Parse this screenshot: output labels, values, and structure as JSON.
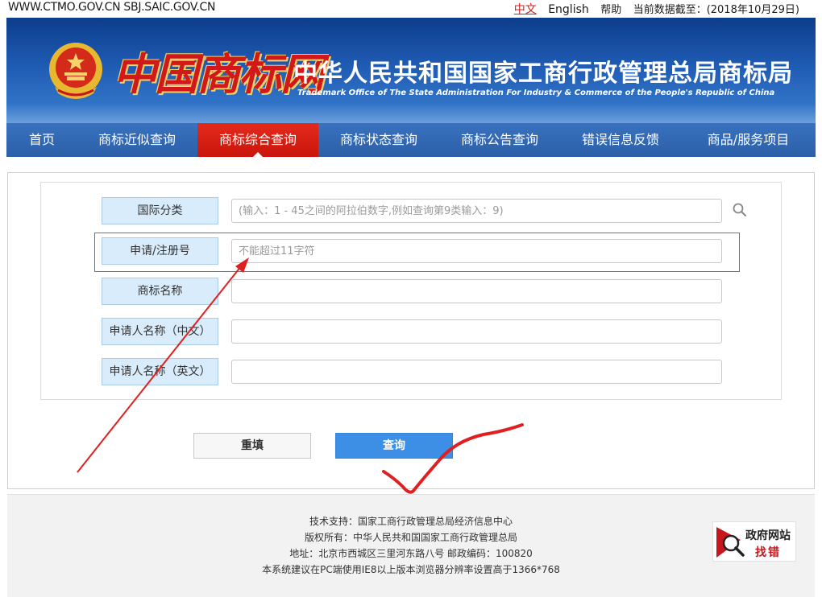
{
  "topbar": {
    "domains": "WWW.CTMO.GOV.CN SBJ.SAIC.GOV.CN",
    "lang_zh": "中文",
    "lang_en": "English",
    "help": "帮助",
    "data_date": "当前数据截至：(2018年10月29日)"
  },
  "banner": {
    "logo_text": "中国商标网",
    "title": "中华人民共和国国家工商行政管理总局商标局",
    "subtitle": "Trademark Office of The State Administration For Industry & Commerce of the People's Republic of China"
  },
  "nav": {
    "items": [
      "首页",
      "商标近似查询",
      "商标综合查询",
      "商标状态查询",
      "商标公告查询",
      "错误信息反馈",
      "商品/服务项目"
    ],
    "active": "商标综合查询"
  },
  "form": {
    "fields": [
      {
        "label": "国际分类",
        "placeholder": "(输入：1 - 45之间的阿拉伯数字,例如查询第9类输入：9)"
      },
      {
        "label": "申请/注册号",
        "placeholder": "不能超过11字符"
      },
      {
        "label": "商标名称",
        "placeholder": ""
      },
      {
        "label": "申请人名称（中文）",
        "placeholder": ""
      },
      {
        "label": "申请人名称（英文）",
        "placeholder": ""
      }
    ],
    "reset_label": "重填",
    "query_label": "查询"
  },
  "footer": {
    "lines": [
      "技术支持：国家工商行政管理总局经济信息中心",
      "版权所有：中华人民共和国国家工商行政管理总局",
      "地址：北京市西城区三里河东路八号  邮政编码：100820",
      "本系统建议在PC端使用IE8以上版本浏览器分辨率设置高于1366*768"
    ],
    "badge_line1": "政府网站",
    "badge_line2": "找错"
  },
  "colors": {
    "banner_blue": "#1f5bb3",
    "nav_blue": "#2b5fa8",
    "nav_active_red": "#c9150c",
    "label_bg": "#d9ecfb",
    "query_button": "#3d8fe6",
    "annotation_red": "#e02020"
  },
  "icons": [
    "national-emblem-icon",
    "search-icon",
    "government-site-error-report-icon"
  ]
}
